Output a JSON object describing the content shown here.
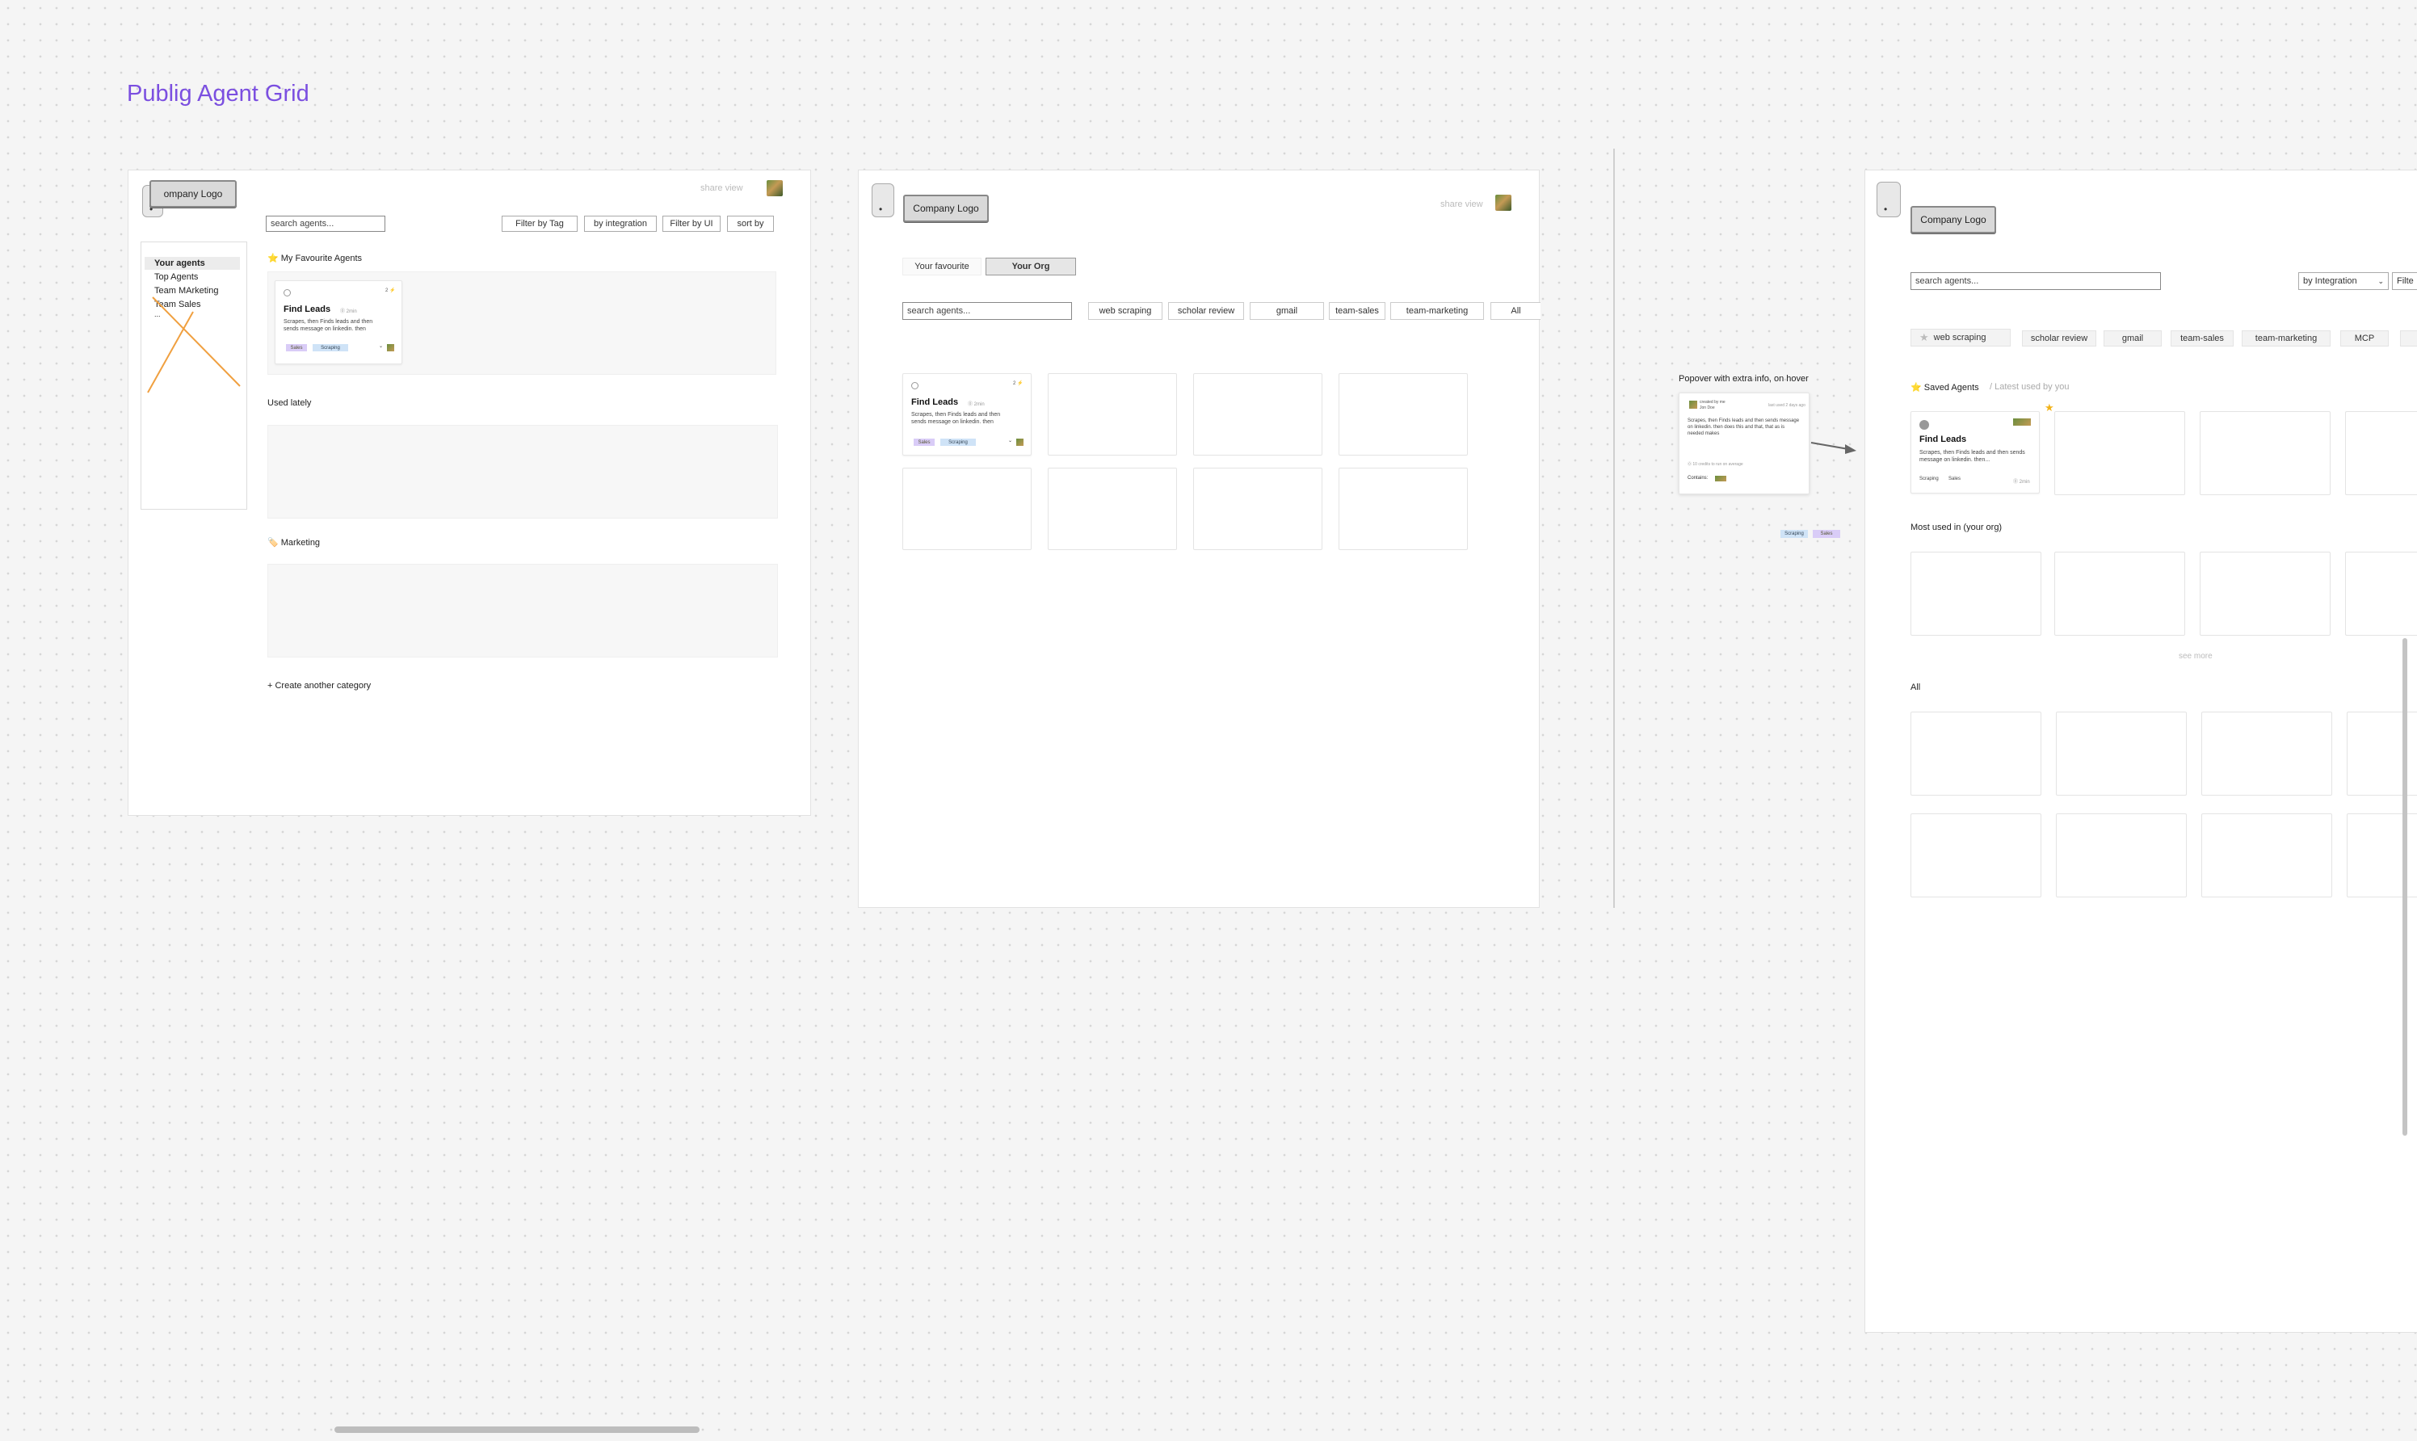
{
  "page_title": "Publig Agent Grid",
  "annotation": "Popover with extra info, on hover",
  "colors": {
    "accent": "#7b4fe0",
    "sales_tag": "#d9ccf7",
    "scraping_tag": "#cfe3f7",
    "cross_out": "#f0a040"
  },
  "frame1": {
    "logo": "ompany Logo",
    "share": "share view",
    "search_placeholder": "search agents...",
    "filters": [
      "Filter by Tag",
      "by integration",
      "Filter by UI",
      "sort by"
    ],
    "sidebar": [
      "Your agents",
      "Top Agents",
      "Team MArketing",
      "Team Sales",
      "..."
    ],
    "favourites_label": "⭐ My Favourite Agents",
    "used_lately": "Used lately",
    "marketing_label": "🏷️ Marketing",
    "create_category": "+ Create another category",
    "card": {
      "title": "Find Leads",
      "meta": "⓪ 2min",
      "count": "2 ⚡",
      "desc": "Scrapes, then Finds leads and then sends message on linkedin. then",
      "tag1": "Sales",
      "tag2": "Scraping",
      "chevron": "⌄"
    }
  },
  "frame2": {
    "logo": "Company Logo",
    "share": "share view",
    "tabs": [
      "Your favourite",
      "Your Org"
    ],
    "search_placeholder": "search agents...",
    "chips": [
      "web scraping",
      "scholar review",
      "gmail",
      "team-sales",
      "team-marketing",
      "All"
    ],
    "card": {
      "title": "Find Leads",
      "meta": "⓪ 2min",
      "count": "2 ⚡",
      "desc": "Scrapes, then Finds leads and then sends message on linkedin. then",
      "tag1": "Sales",
      "tag2": "Scraping",
      "chevron": "⌄"
    }
  },
  "popover": {
    "author": "created by me",
    "author_sub": "Jon Doe",
    "right": "last used 2 days ago",
    "desc": "Scrapes, then Finds leads and then sends message on linkedin. then does this and that, that as is needed makes",
    "footer": "⓪ 10 credits to run on average",
    "contains": "Contains:",
    "chips": [
      "Scraping",
      "Sales"
    ]
  },
  "frame3": {
    "logo": "Company Logo",
    "search_placeholder": "search agents...",
    "integration_select": "by Integration",
    "filter_cut": "Filte",
    "chips": [
      "web scraping",
      "scholar review",
      "gmail",
      "team-sales",
      "team-marketing",
      "MCP"
    ],
    "saved_label": "⭐ Saved Agents",
    "latest_label": "/ Latest used by you",
    "most_used": "Most used in (your org)",
    "see_more": "see more",
    "all_label": "All",
    "card": {
      "title": "Find Leads",
      "desc": "Scrapes, then Finds leads and then sends message on linkedin. then...",
      "tag1": "Scraping",
      "tag2": "Sales",
      "meta": "⓪ 2min"
    }
  }
}
